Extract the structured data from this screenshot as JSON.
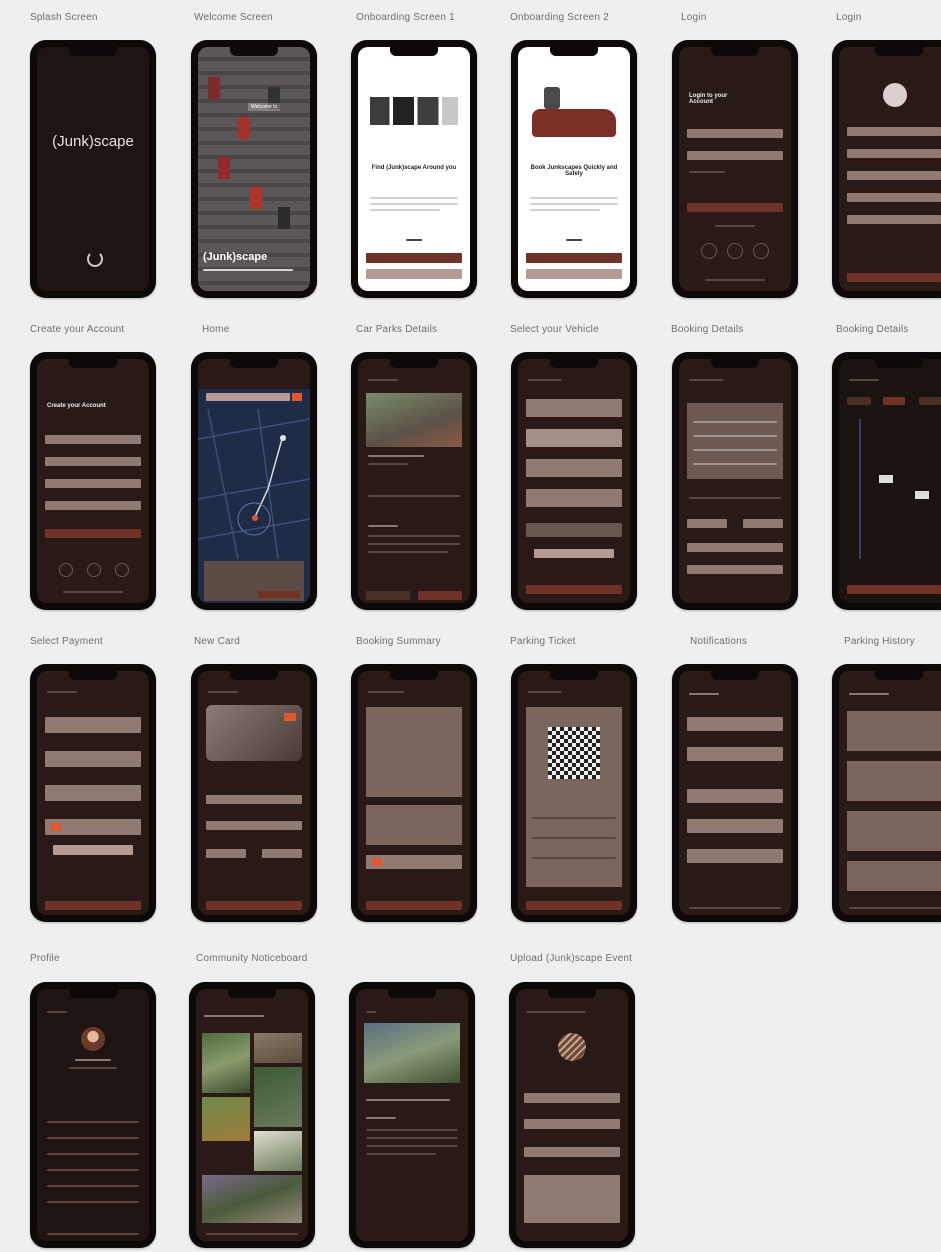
{
  "labels": {
    "splash": "Splash Screen",
    "welcome": "Welcome Screen",
    "onboarding1": "Onboarding Screen 1",
    "onboarding2": "Onboarding Screen 2",
    "login1": "Login",
    "login2": "Login",
    "create_account": "Create your Account",
    "home": "Home",
    "car_parks_details": "Car Parks Details",
    "select_vehicle": "Select your Vehicle",
    "booking_details1": "Booking Details",
    "booking_details2": "Booking Details",
    "select_payment": "Select Payment",
    "new_card": "New Card",
    "booking_summary": "Booking Summary",
    "parking_ticket": "Parking Ticket",
    "notifications": "Notifications",
    "parking_history": "Parking History",
    "profile": "Profile",
    "community_noticeboard": "Community Noticeboard",
    "upload_event": "Upload (Junk)scape Event"
  },
  "screens": {
    "splash_logo": "(Junk)scape",
    "welcome_logo": "(Junk)scape",
    "welcome_banner": "Welcome to",
    "onboarding1_title": "Find (Junk)scape Around you",
    "onboarding2_title": "Book Junkscapes Quickly and Safely",
    "login_title": "Login to your Account",
    "create_title": "Create your Account"
  },
  "colors": {
    "page_bg": "#efefef",
    "screen_bg": "#2a1a17",
    "field": "#8f7a74",
    "accent": "#6e3326",
    "map_bg": "#1f2b47"
  }
}
